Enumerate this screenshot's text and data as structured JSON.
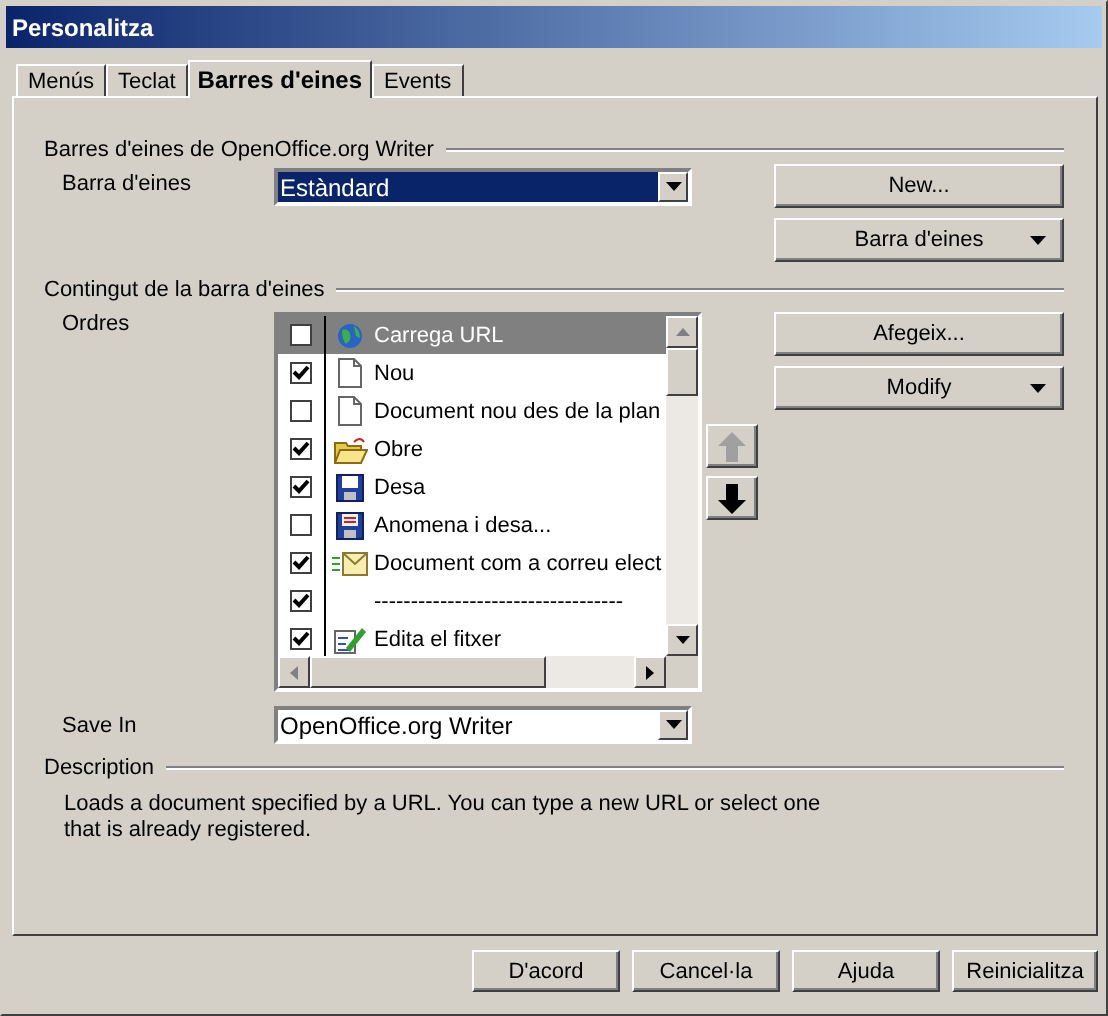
{
  "window": {
    "title": "Personalitza"
  },
  "tabs": [
    {
      "label": "Menús",
      "selected": false
    },
    {
      "label": "Teclat",
      "selected": false
    },
    {
      "label": "Barres d'eines",
      "selected": true
    },
    {
      "label": "Events",
      "selected": false
    }
  ],
  "toolbars_section": {
    "heading": "Barres d'eines de OpenOffice.org Writer",
    "toolbar_label": "Barra d'eines",
    "toolbar_value": "Estàndard",
    "buttons": [
      {
        "label": "New...",
        "kind": "plain"
      },
      {
        "label": "Barra d'eines",
        "kind": "menu"
      }
    ]
  },
  "contents_section": {
    "heading": "Contingut de la barra d'eines",
    "commands_label": "Ordres",
    "commands": [
      {
        "label": "Carrega URL",
        "checked": false,
        "selected": true,
        "kind": "globe"
      },
      {
        "label": "Nou",
        "checked": true,
        "selected": false,
        "kind": "document"
      },
      {
        "label": "Document nou des de la plan",
        "checked": false,
        "selected": false,
        "kind": "document"
      },
      {
        "label": "Obre",
        "checked": true,
        "selected": false,
        "kind": "folder"
      },
      {
        "label": "Desa",
        "checked": true,
        "selected": false,
        "kind": "floppy"
      },
      {
        "label": "Anomena i desa...",
        "checked": false,
        "selected": false,
        "kind": "floppy-red"
      },
      {
        "label": "Document com a correu elect",
        "checked": true,
        "selected": false,
        "kind": "envelope"
      },
      {
        "label": "----------------------------------",
        "checked": true,
        "selected": false,
        "kind": "none"
      },
      {
        "label": "Edita el fitxer",
        "checked": true,
        "selected": false,
        "kind": "edit"
      }
    ],
    "move_buttons": [
      {
        "kind": "up",
        "disabled": true
      },
      {
        "kind": "down",
        "disabled": false
      }
    ],
    "buttons": [
      {
        "label": "Afegeix...",
        "kind": "plain"
      },
      {
        "label": "Modify",
        "kind": "menu"
      }
    ]
  },
  "save_in": {
    "label": "Save In",
    "value": "OpenOffice.org Writer"
  },
  "description": {
    "heading": "Description",
    "text": "Loads a document specified by a URL. You can type a new URL or select one that is already registered."
  },
  "footer_buttons": [
    "D'acord",
    "Cancel·la",
    "Ajuda",
    "Reinicialitza"
  ]
}
